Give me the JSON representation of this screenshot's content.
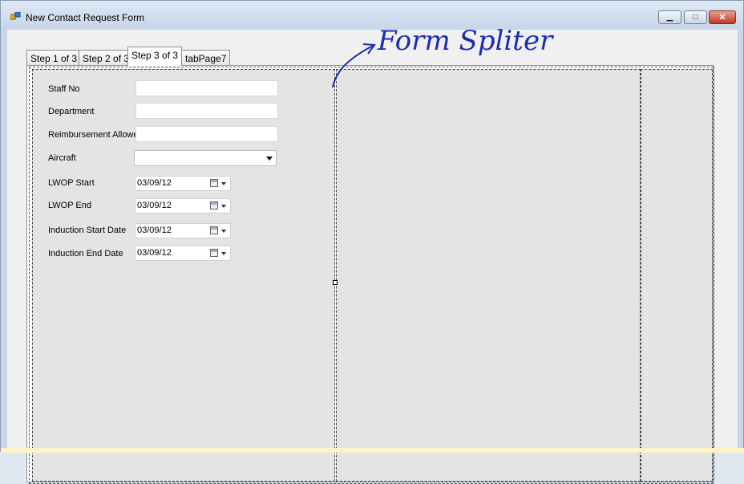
{
  "window": {
    "title": "New Contact Request Form"
  },
  "tabs": [
    {
      "label": "Step 1 of 3"
    },
    {
      "label": "Step 2 of 3"
    },
    {
      "label": "Step 3 of 3",
      "active": true
    },
    {
      "label": "tabPage7"
    }
  ],
  "form": {
    "staff_no": {
      "label": "Staff No",
      "value": ""
    },
    "department": {
      "label": "Department",
      "value": ""
    },
    "reimbursement": {
      "label": "Reimbursement Allowe",
      "value": ""
    },
    "aircraft": {
      "label": "Aircraft",
      "value": ""
    },
    "lwop_start": {
      "label": "LWOP Start",
      "value": "03/09/12"
    },
    "lwop_end": {
      "label": "LWOP End",
      "value": "03/09/12"
    },
    "induction_start": {
      "label": "Induction Start Date",
      "value": "03/09/12"
    },
    "induction_end": {
      "label": "Induction End Date",
      "value": "03/09/12"
    }
  },
  "annotation": {
    "text": "Form Spliter",
    "color": "#1a2bb5"
  },
  "colors": {
    "panel": "#e4e4e4",
    "titlebar": "#c6d5e8",
    "close": "#c2381f"
  },
  "icons": [
    "app-icon",
    "minimize-icon",
    "maximize-icon",
    "close-icon",
    "calendar-icon",
    "dropdown-arrow-icon"
  ]
}
